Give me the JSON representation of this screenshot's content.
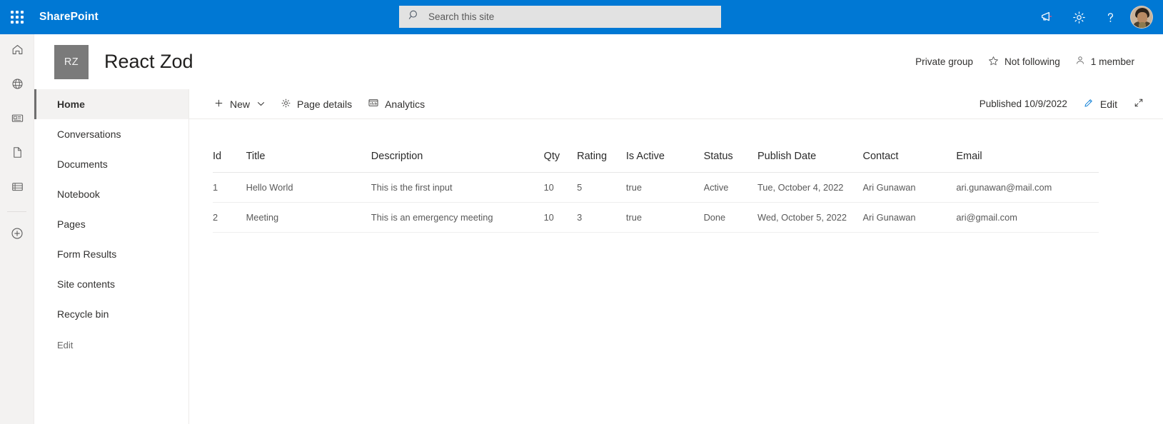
{
  "suitebar": {
    "brand": "SharePoint",
    "waffle_label": "app-launcher",
    "search": {
      "placeholder": "Search this site",
      "value": ""
    },
    "actions": [
      {
        "name": "megaphone-icon",
        "label": "Announcements"
      },
      {
        "name": "gear-icon",
        "label": "Settings"
      },
      {
        "name": "help-icon",
        "label": "Help"
      }
    ],
    "avatar_label": "User account"
  },
  "rail": {
    "items": [
      {
        "name": "home-icon",
        "label": "Home"
      },
      {
        "name": "globe-icon",
        "label": "Websites"
      },
      {
        "name": "news-icon",
        "label": "News"
      },
      {
        "name": "page-icon",
        "label": "Pages"
      },
      {
        "name": "list-icon",
        "label": "Lists"
      },
      {
        "name": "create-icon",
        "label": "Create"
      }
    ]
  },
  "site": {
    "logo_initials": "RZ",
    "title": "React Zod",
    "privacy": "Private group",
    "follow_label": "Not following",
    "members_label": "1 member"
  },
  "leftnav": {
    "items": [
      {
        "label": "Home",
        "selected": true
      },
      {
        "label": "Conversations",
        "selected": false
      },
      {
        "label": "Documents",
        "selected": false
      },
      {
        "label": "Notebook",
        "selected": false
      },
      {
        "label": "Pages",
        "selected": false
      },
      {
        "label": "Form Results",
        "selected": false
      },
      {
        "label": "Site contents",
        "selected": false
      },
      {
        "label": "Recycle bin",
        "selected": false
      }
    ],
    "edit_label": "Edit"
  },
  "commandbar": {
    "new_label": "New",
    "page_details_label": "Page details",
    "analytics_label": "Analytics",
    "published_label": "Published 10/9/2022",
    "edit_label": "Edit",
    "fullscreen_label": "Full screen"
  },
  "table": {
    "columns": [
      "Id",
      "Title",
      "Description",
      "Qty",
      "Rating",
      "Is Active",
      "Status",
      "Publish Date",
      "Contact",
      "Email"
    ],
    "rows": [
      {
        "id": "1",
        "title": "Hello World",
        "description": "This is the first input",
        "qty": "10",
        "rating": "5",
        "is_active": "true",
        "status": "Active",
        "publish_date": "Tue, October 4, 2022",
        "contact": "Ari Gunawan",
        "email": "ari.gunawan@mail.com"
      },
      {
        "id": "2",
        "title": "Meeting",
        "description": "This is an emergency meeting",
        "qty": "10",
        "rating": "3",
        "is_active": "true",
        "status": "Done",
        "publish_date": "Wed, October 5, 2022",
        "contact": "Ari Gunawan",
        "email": "ari@gmail.com"
      }
    ]
  },
  "colors": {
    "brand_blue": "#0078d4",
    "rail_bg": "#f3f2f1",
    "logo_gray": "#7a7a7a",
    "text_primary": "#323130"
  }
}
